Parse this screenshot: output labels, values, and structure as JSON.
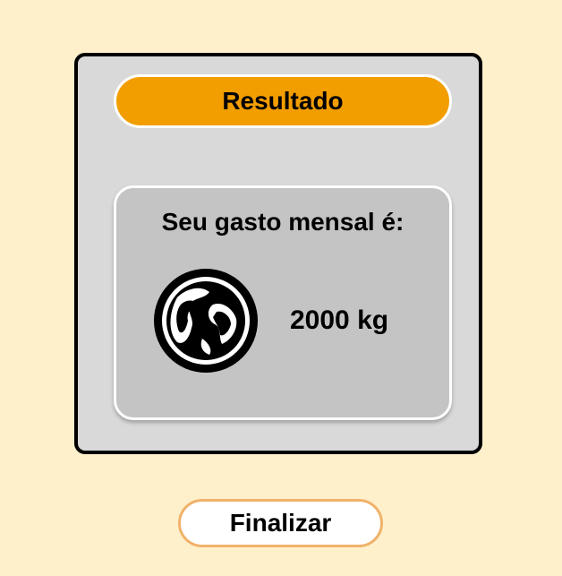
{
  "result_card": {
    "title": "Resultado",
    "monthly_label": "Seu gasto mensal é:",
    "amount": "2000 kg",
    "icon": "globe-icon"
  },
  "actions": {
    "finish_label": "Finalizar"
  },
  "colors": {
    "background": "#FFF0CC",
    "card": "#D9D9D9",
    "title_pill": "#F29D00",
    "inner_box": "#C4C4C4",
    "button_border": "#F0B26A"
  }
}
